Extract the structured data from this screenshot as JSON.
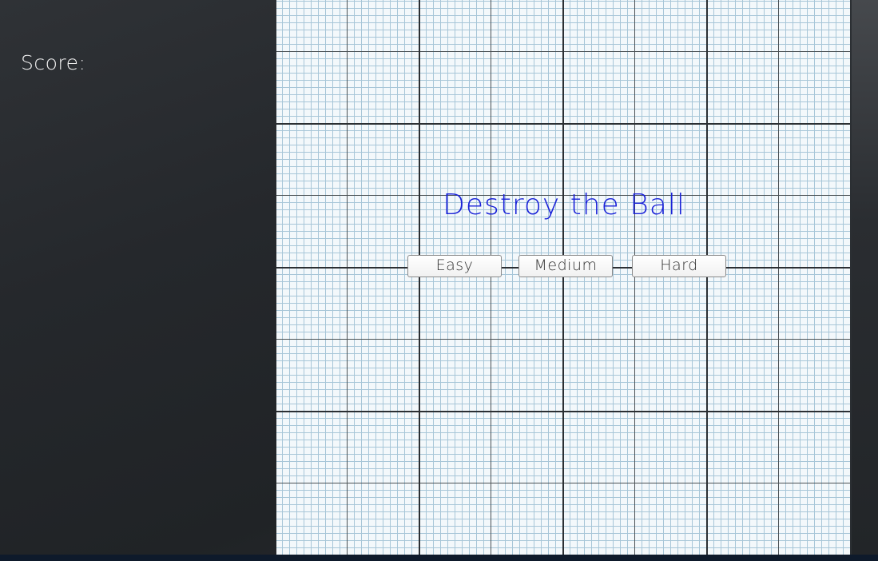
{
  "sidebar": {
    "score_label": "Score:"
  },
  "game": {
    "title": "Destroy the Ball",
    "buttons": {
      "easy": "Easy",
      "medium": "Medium",
      "hard": "Hard"
    }
  },
  "colors": {
    "title": "#1a22d8",
    "board_background": "#f3f8fb",
    "grid_minor": "#a7c6d8",
    "grid_major": "#2b2f33",
    "sidebar_background": "#25282c"
  }
}
